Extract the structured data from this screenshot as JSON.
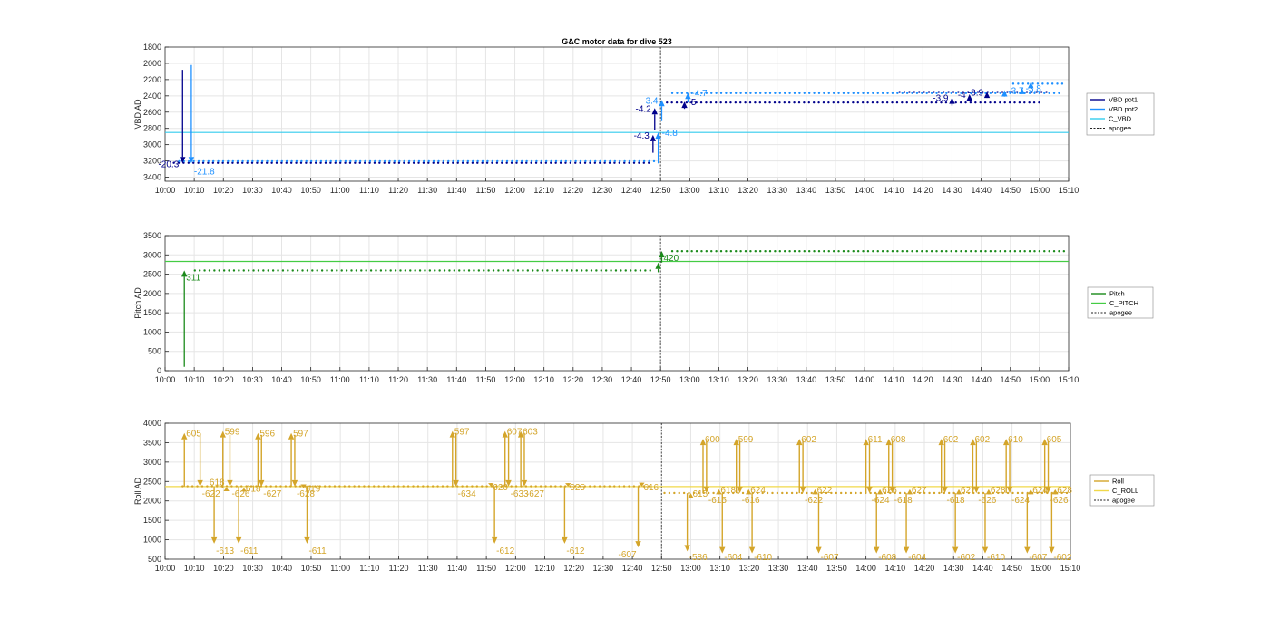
{
  "title": "G&C motor data for dive 523",
  "colors": {
    "vbd_pot1": "#00008b",
    "vbd_pot2": "#1e90ff",
    "c_vbd": "#33ccee",
    "pitch": "#1a8a1a",
    "c_pitch": "#44cc44",
    "roll": "#d4a52a",
    "c_roll": "#f0d84a",
    "apogee": "#222222",
    "grid": "#e5e5e5"
  },
  "chart_data": [
    {
      "id": "vbd",
      "type": "scatter",
      "ylabel": "VBD AD",
      "y_reversed": true,
      "ylim": [
        1800,
        3450
      ],
      "yticks": [
        1800,
        2000,
        2200,
        2400,
        2600,
        2800,
        3000,
        3200,
        3400
      ],
      "xlim_hours": [
        10.0,
        15.1667
      ],
      "xticks": [
        "10:00",
        "10:10",
        "10:20",
        "10:30",
        "10:40",
        "10:50",
        "11:00",
        "11:10",
        "11:20",
        "11:30",
        "11:40",
        "11:50",
        "12:00",
        "12:10",
        "12:20",
        "12:30",
        "12:40",
        "12:50",
        "13:00",
        "13:10",
        "13:20",
        "13:30",
        "13:40",
        "13:50",
        "14:00",
        "14:10",
        "14:20",
        "14:30",
        "14:40",
        "14:50",
        "15:00",
        "15:10"
      ],
      "apogee_hours": 12.833,
      "reference": {
        "name": "C_VBD",
        "value": 2850
      },
      "series": [
        {
          "name": "VBD pot1",
          "segments": [
            [
              10.05,
              12.78,
              3220
            ],
            [
              12.87,
              15.0,
              2480
            ],
            [
              14.2,
              15.05,
              2350
            ]
          ]
        },
        {
          "name": "VBD pot2",
          "segments": [
            [
              10.08,
              12.8,
              3210
            ],
            [
              12.9,
              15.12,
              2360
            ],
            [
              14.85,
              15.15,
              2250
            ]
          ]
        }
      ],
      "arrows": [
        {
          "x": 10.1,
          "y0": 2080,
          "y1": 3230,
          "series": "VBD pot1",
          "label": "-20.3",
          "label_side": "left"
        },
        {
          "x": 10.15,
          "y0": 2020,
          "y1": 3230,
          "series": "VBD pot2",
          "label": "-21.8",
          "label_side": "below"
        },
        {
          "x": 12.79,
          "y0": 3100,
          "y1": 2880,
          "series": "VBD pot1",
          "label": "-4.3",
          "label_side": "left"
        },
        {
          "x": 12.8,
          "y0": 2820,
          "y1": 2550,
          "series": "VBD pot1",
          "label": "-4.2",
          "label_side": "left"
        },
        {
          "x": 12.82,
          "y0": 3230,
          "y1": 2850,
          "series": "VBD pot2",
          "label": "-4.8",
          "label_side": "right"
        },
        {
          "x": 12.84,
          "y0": 2700,
          "y1": 2450,
          "series": "VBD pot2",
          "label": "-3.4",
          "label_side": "left"
        },
        {
          "x": 12.97,
          "y0": 2560,
          "y1": 2470,
          "series": "VBD pot1",
          "label": "-5",
          "label_side": "right"
        },
        {
          "x": 12.99,
          "y0": 2480,
          "y1": 2360,
          "series": "VBD pot2",
          "label": "-4.7",
          "label_side": "right"
        },
        {
          "x": 14.5,
          "y0": 2520,
          "y1": 2420,
          "series": "VBD pot1",
          "label": "-3.9",
          "label_side": "left"
        },
        {
          "x": 14.6,
          "y0": 2470,
          "y1": 2380,
          "series": "VBD pot1",
          "label": "-4",
          "label_side": "left"
        },
        {
          "x": 14.7,
          "y0": 2420,
          "y1": 2350,
          "series": "VBD pot1",
          "label": "-3.9",
          "label_side": "left"
        },
        {
          "x": 14.8,
          "y0": 2410,
          "y1": 2330,
          "series": "VBD pot2",
          "label": "-3.7",
          "label_side": "right"
        },
        {
          "x": 14.9,
          "y0": 2380,
          "y1": 2300,
          "series": "VBD pot2",
          "label": "-3.8",
          "label_side": "right"
        },
        {
          "x": 14.95,
          "y0": 2300,
          "y1": 2230,
          "series": "VBD pot2",
          "label": "",
          "label_side": "right"
        }
      ],
      "legend": [
        "VBD pot1",
        "VBD pot2",
        "C_VBD",
        "apogee"
      ]
    },
    {
      "id": "pitch",
      "type": "scatter",
      "ylabel": "Pitch AD",
      "y_reversed": false,
      "ylim": [
        0,
        3500
      ],
      "yticks": [
        0,
        500,
        1000,
        1500,
        2000,
        2500,
        3000,
        3500
      ],
      "xlim_hours": [
        10.0,
        15.1667
      ],
      "xticks": [
        "10:00",
        "10:10",
        "10:20",
        "10:30",
        "10:40",
        "10:50",
        "11:00",
        "11:10",
        "11:20",
        "11:30",
        "11:40",
        "11:50",
        "12:00",
        "12:10",
        "12:20",
        "12:30",
        "12:40",
        "12:50",
        "13:00",
        "13:10",
        "13:20",
        "13:30",
        "13:40",
        "13:50",
        "14:00",
        "14:10",
        "14:20",
        "14:30",
        "14:40",
        "14:50",
        "15:00",
        "15:10"
      ],
      "apogee_hours": 12.833,
      "reference": {
        "name": "C_PITCH",
        "value": 2830
      },
      "series": [
        {
          "name": "Pitch",
          "segments": [
            [
              10.17,
              12.78,
              2590
            ],
            [
              12.9,
              15.15,
              3090
            ]
          ]
        }
      ],
      "arrows": [
        {
          "x": 10.11,
          "y0": 100,
          "y1": 2600,
          "series": "Pitch",
          "label": "311",
          "label_side": "below-right"
        },
        {
          "x": 12.82,
          "y0": 2550,
          "y1": 2800,
          "series": "Pitch",
          "label": "",
          "label_side": "right"
        },
        {
          "x": 12.84,
          "y0": 2800,
          "y1": 3100,
          "series": "Pitch",
          "label": "420",
          "label_side": "below-right"
        }
      ],
      "legend": [
        "Pitch",
        "C_PITCH",
        "apogee"
      ]
    },
    {
      "id": "roll",
      "type": "scatter",
      "ylabel": "Roll AD",
      "y_reversed": false,
      "ylim": [
        500,
        4000
      ],
      "yticks": [
        500,
        1000,
        1500,
        2000,
        2500,
        3000,
        3500,
        4000
      ],
      "xlim_hours": [
        10.0,
        15.1667
      ],
      "xticks": [
        "10:00",
        "10:10",
        "10:20",
        "10:30",
        "10:40",
        "10:50",
        "11:00",
        "11:10",
        "11:20",
        "11:30",
        "11:40",
        "11:50",
        "12:00",
        "12:10",
        "12:20",
        "12:30",
        "12:40",
        "12:50",
        "13:00",
        "13:10",
        "13:20",
        "13:30",
        "13:40",
        "13:50",
        "14:00",
        "14:10",
        "14:20",
        "14:30",
        "14:40",
        "14:50",
        "15:00",
        "15:10"
      ],
      "apogee_hours": 12.833,
      "reference": {
        "name": "C_ROLL",
        "value": 2370
      },
      "series": [
        {
          "name": "Roll",
          "segments": [
            [
              10.1,
              12.78,
              2370
            ],
            [
              12.85,
              15.15,
              2200
            ]
          ]
        }
      ],
      "arrows": [
        {
          "x": 10.11,
          "y0": 2370,
          "y1": 3750,
          "label": "605",
          "label_side": "top-right"
        },
        {
          "x": 10.2,
          "y0": 3700,
          "y1": 2370,
          "label": "-622",
          "label_side": "below-right"
        },
        {
          "x": 10.28,
          "y0": 2370,
          "y1": 900,
          "label": "-613",
          "label_side": "below-right"
        },
        {
          "x": 10.33,
          "y0": 2320,
          "y1": 3800,
          "label": "599",
          "label_side": "top-right"
        },
        {
          "x": 10.35,
          "y0": 2300,
          "y1": 2350,
          "label": "618",
          "label_side": "top-left"
        },
        {
          "x": 10.37,
          "y0": 3700,
          "y1": 2370,
          "label": "-626",
          "label_side": "below-right"
        },
        {
          "x": 10.42,
          "y0": 2370,
          "y1": 900,
          "label": "-611",
          "label_side": "below-right"
        },
        {
          "x": 10.45,
          "y0": 2300,
          "y1": 2330,
          "label": "618",
          "label_side": "top-right"
        },
        {
          "x": 10.53,
          "y0": 2370,
          "y1": 3750,
          "label": "596",
          "label_side": "top-right"
        },
        {
          "x": 10.55,
          "y0": 3700,
          "y1": 2370,
          "label": "-627",
          "label_side": "below-right"
        },
        {
          "x": 10.72,
          "y0": 2370,
          "y1": 3750,
          "label": "597",
          "label_side": "top-right"
        },
        {
          "x": 10.74,
          "y0": 3700,
          "y1": 2370,
          "label": "-628",
          "label_side": "below-right"
        },
        {
          "x": 10.79,
          "y0": 2370,
          "y1": 2330,
          "label": "619",
          "label_side": "top-right"
        },
        {
          "x": 10.81,
          "y0": 2370,
          "y1": 900,
          "label": "-611",
          "label_side": "below-right"
        },
        {
          "x": 11.64,
          "y0": 2370,
          "y1": 3800,
          "label": "597",
          "label_side": "top-right"
        },
        {
          "x": 11.66,
          "y0": 3750,
          "y1": 2370,
          "label": "-634",
          "label_side": "below-right"
        },
        {
          "x": 11.86,
          "y0": 2400,
          "y1": 2370,
          "label": "620",
          "label_side": "top-right"
        },
        {
          "x": 11.88,
          "y0": 2370,
          "y1": 900,
          "label": "-612",
          "label_side": "below-right"
        },
        {
          "x": 11.94,
          "y0": 2370,
          "y1": 3800,
          "label": "607",
          "label_side": "top-right"
        },
        {
          "x": 11.96,
          "y0": 3750,
          "y1": 2370,
          "label": "-633",
          "label_side": "below-right"
        },
        {
          "x": 12.03,
          "y0": 2370,
          "y1": 3800,
          "label": "603",
          "label_side": "top-right"
        },
        {
          "x": 12.05,
          "y0": 3750,
          "y1": 2370,
          "label": "-627",
          "label_side": "below-right"
        },
        {
          "x": 12.28,
          "y0": 2370,
          "y1": 900,
          "label": "-612",
          "label_side": "below-right"
        },
        {
          "x": 12.3,
          "y0": 2400,
          "y1": 2370,
          "label": "625",
          "label_side": "top-right"
        },
        {
          "x": 12.7,
          "y0": 2370,
          "y1": 800,
          "label": "-607",
          "label_side": "below-left"
        },
        {
          "x": 12.72,
          "y0": 2420,
          "y1": 2370,
          "label": "616",
          "label_side": "top-right"
        },
        {
          "x": 12.98,
          "y0": 2200,
          "y1": 700,
          "label": "-586",
          "label_side": "below-right"
        },
        {
          "x": 13.0,
          "y0": 2100,
          "y1": 2200,
          "label": "615",
          "label_side": "top-right"
        },
        {
          "x": 13.07,
          "y0": 2200,
          "y1": 3600,
          "label": "600",
          "label_side": "top-right"
        },
        {
          "x": 13.09,
          "y0": 3550,
          "y1": 2200,
          "label": "-615",
          "label_side": "below-right"
        },
        {
          "x": 13.16,
          "y0": 2200,
          "y1": 2300,
          "label": "618",
          "label_side": "top-right"
        },
        {
          "x": 13.18,
          "y0": 2200,
          "y1": 650,
          "label": "-604",
          "label_side": "below-right"
        },
        {
          "x": 13.26,
          "y0": 2200,
          "y1": 3600,
          "label": "599",
          "label_side": "top-right"
        },
        {
          "x": 13.28,
          "y0": 3550,
          "y1": 2200,
          "label": "-616",
          "label_side": "below-right"
        },
        {
          "x": 13.33,
          "y0": 2200,
          "y1": 2300,
          "label": "624",
          "label_side": "top-right"
        },
        {
          "x": 13.35,
          "y0": 2200,
          "y1": 650,
          "label": "-610",
          "label_side": "below-right"
        },
        {
          "x": 13.62,
          "y0": 2200,
          "y1": 3600,
          "label": "602",
          "label_side": "top-right"
        },
        {
          "x": 13.64,
          "y0": 3550,
          "y1": 2200,
          "label": "-622",
          "label_side": "below-right"
        },
        {
          "x": 13.71,
          "y0": 2200,
          "y1": 2300,
          "label": "622",
          "label_side": "top-right"
        },
        {
          "x": 13.73,
          "y0": 2200,
          "y1": 650,
          "label": "-607",
          "label_side": "below-right"
        },
        {
          "x": 14.0,
          "y0": 2200,
          "y1": 3600,
          "label": "611",
          "label_side": "top-right"
        },
        {
          "x": 14.02,
          "y0": 3550,
          "y1": 2200,
          "label": "-624",
          "label_side": "below-right"
        },
        {
          "x": 14.06,
          "y0": 2200,
          "y1": 650,
          "label": "-608",
          "label_side": "below-right"
        },
        {
          "x": 14.08,
          "y0": 2200,
          "y1": 2300,
          "label": "625",
          "label_side": "top-right"
        },
        {
          "x": 14.13,
          "y0": 2200,
          "y1": 3600,
          "label": "608",
          "label_side": "top-right"
        },
        {
          "x": 14.15,
          "y0": 3550,
          "y1": 2200,
          "label": "-618",
          "label_side": "below-right"
        },
        {
          "x": 14.23,
          "y0": 2200,
          "y1": 650,
          "label": "-604",
          "label_side": "below-right"
        },
        {
          "x": 14.25,
          "y0": 2200,
          "y1": 2300,
          "label": "627",
          "label_side": "top-right"
        },
        {
          "x": 14.43,
          "y0": 2200,
          "y1": 3600,
          "label": "602",
          "label_side": "top-right"
        },
        {
          "x": 14.45,
          "y0": 3550,
          "y1": 2200,
          "label": "-618",
          "label_side": "below-right"
        },
        {
          "x": 14.51,
          "y0": 2200,
          "y1": 650,
          "label": "-602",
          "label_side": "below-right"
        },
        {
          "x": 14.53,
          "y0": 2200,
          "y1": 2300,
          "label": "627",
          "label_side": "top-right"
        },
        {
          "x": 14.61,
          "y0": 2200,
          "y1": 3600,
          "label": "602",
          "label_side": "top-right"
        },
        {
          "x": 14.63,
          "y0": 3550,
          "y1": 2200,
          "label": "-626",
          "label_side": "below-right"
        },
        {
          "x": 14.68,
          "y0": 2200,
          "y1": 650,
          "label": "-610",
          "label_side": "below-right"
        },
        {
          "x": 14.7,
          "y0": 2200,
          "y1": 2300,
          "label": "628",
          "label_side": "top-right"
        },
        {
          "x": 14.8,
          "y0": 2200,
          "y1": 3600,
          "label": "610",
          "label_side": "top-right"
        },
        {
          "x": 14.82,
          "y0": 3550,
          "y1": 2200,
          "label": "-624",
          "label_side": "below-right"
        },
        {
          "x": 14.92,
          "y0": 2200,
          "y1": 650,
          "label": "-607",
          "label_side": "below-right"
        },
        {
          "x": 14.94,
          "y0": 2200,
          "y1": 2300,
          "label": "624",
          "label_side": "top-right"
        },
        {
          "x": 15.02,
          "y0": 2200,
          "y1": 3600,
          "label": "605",
          "label_side": "top-right"
        },
        {
          "x": 15.04,
          "y0": 3550,
          "y1": 2200,
          "label": "-626",
          "label_side": "below-right"
        },
        {
          "x": 15.06,
          "y0": 2200,
          "y1": 650,
          "label": "-602",
          "label_side": "below-right"
        },
        {
          "x": 15.08,
          "y0": 2200,
          "y1": 2300,
          "label": "628",
          "label_side": "top-right"
        }
      ],
      "legend": [
        "Roll",
        "C_ROLL",
        "apogee"
      ]
    }
  ]
}
